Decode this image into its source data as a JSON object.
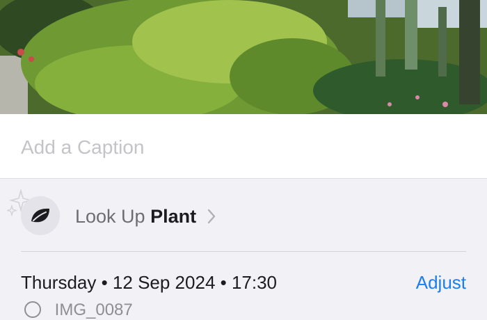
{
  "photo": {
    "icon": "garden-photo"
  },
  "caption": {
    "placeholder": "Add a Caption"
  },
  "lookup": {
    "prefix": "Look Up",
    "subject": "Plant",
    "icon": "leaf-icon"
  },
  "info": {
    "datetime": "Thursday • 12 Sep 2024 • 17:30",
    "adjust_label": "Adjust",
    "filename": "IMG_0087"
  },
  "colors": {
    "accent": "#1a7ef5",
    "background": "#f2f1f6"
  }
}
